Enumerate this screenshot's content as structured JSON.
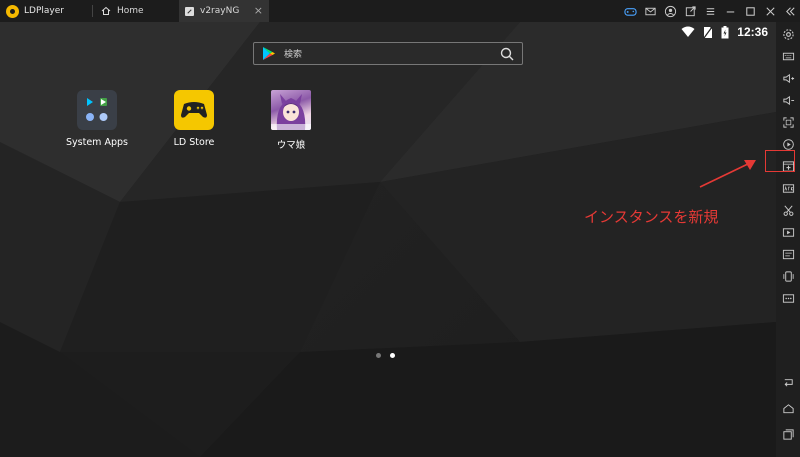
{
  "titlebar": {
    "app_name": "LDPlayer",
    "tabs": [
      {
        "label": "Home",
        "icon": "home-icon"
      },
      {
        "label": "v2rayNG",
        "icon": "app-favicon-icon",
        "close_label": "×"
      }
    ]
  },
  "status": {
    "time": "12:36"
  },
  "search": {
    "placeholder": "検索"
  },
  "apps": [
    {
      "label": "System Apps",
      "icon": "system-apps-icon"
    },
    {
      "label": "LD Store",
      "icon": "ld-store-icon"
    },
    {
      "label": "ウマ娘",
      "icon": "uma-musume-icon"
    }
  ],
  "page_indicator": {
    "pages": 2,
    "current": 2
  },
  "annotation": {
    "text": "インスタンスを新規",
    "color": "#e53935"
  },
  "colors": {
    "accent_yellow": "#f5c700",
    "annotation_red": "#e53935"
  }
}
